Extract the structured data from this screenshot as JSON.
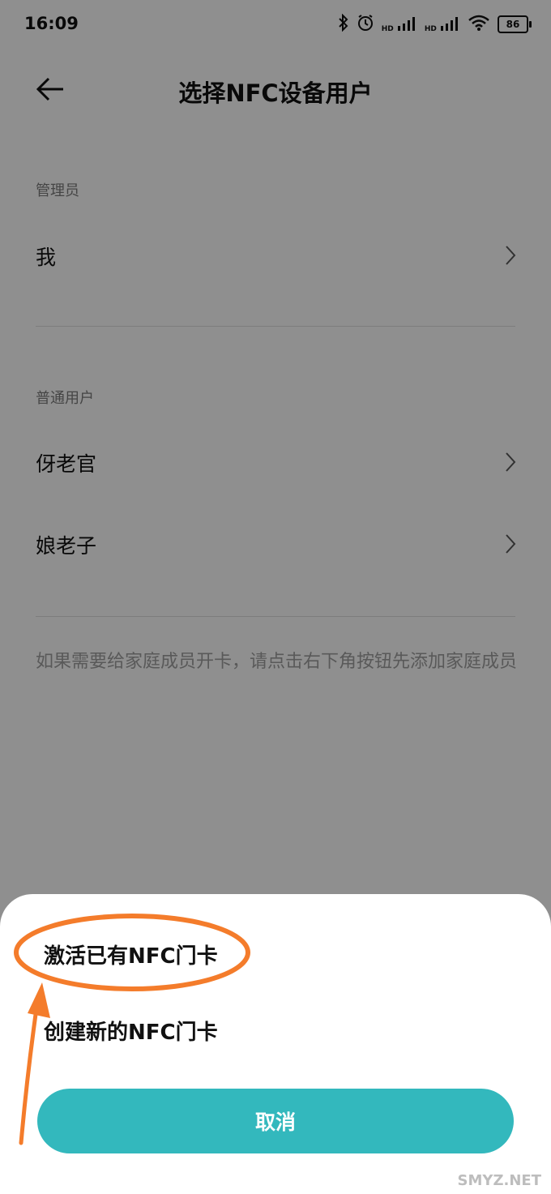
{
  "status": {
    "time": "16:09",
    "battery": "86",
    "hd": "HD"
  },
  "header": {
    "title": "选择NFC设备用户"
  },
  "admin": {
    "label": "管理员",
    "users": [
      {
        "name": "我"
      }
    ]
  },
  "regular": {
    "label": "普通用户",
    "users": [
      {
        "name": "伢老官"
      },
      {
        "name": "娘老子"
      }
    ]
  },
  "hint": "如果需要给家庭成员开卡，请点击右下角按钮先添加家庭成员",
  "sheet": {
    "options": [
      {
        "label": "激活已有NFC门卡"
      },
      {
        "label": "创建新的NFC门卡"
      }
    ],
    "cancel_label": "取消"
  },
  "watermark": "SMYZ.NET",
  "colors": {
    "accent": "#33b8bd",
    "annotation": "#f47c2b"
  }
}
